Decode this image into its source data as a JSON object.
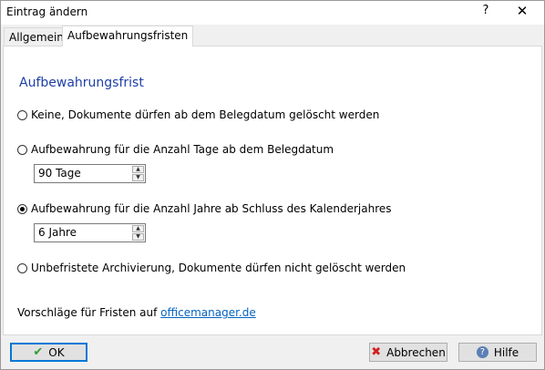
{
  "window": {
    "title": "Eintrag ändern",
    "help_label": "?",
    "close_label": "✕"
  },
  "tabs": [
    {
      "label": "Allgemein",
      "active": false
    },
    {
      "label": "Aufbewahrungsfristen",
      "active": true
    }
  ],
  "section_title": "Aufbewahrungsfrist",
  "options": [
    {
      "label": "Keine, Dokumente dürfen ab dem Belegdatum gelöscht werden",
      "checked": false
    },
    {
      "label": "Aufbewahrung für die Anzahl Tage ab dem Belegdatum",
      "checked": false
    },
    {
      "label": "Aufbewahrung für die Anzahl Jahre ab Schluss des Kalenderjahres",
      "checked": true
    },
    {
      "label": "Unbefristete Archivierung, Dokumente dürfen nicht gelöscht werden",
      "checked": false
    }
  ],
  "days_value": "90 Tage",
  "years_value": "6 Jahre",
  "footer": {
    "text": "Vorschläge für Fristen auf",
    "link": "officemanager.de"
  },
  "buttons": {
    "ok": "OK",
    "cancel": "Abbrechen",
    "help": "Hilfe"
  },
  "icons": {
    "ok": "check-icon",
    "cancel": "x-icon",
    "help": "question-circle-icon"
  },
  "colors": {
    "section_title": "#1e3fa8",
    "link": "#0563c1",
    "ok_border": "#0078d7"
  }
}
